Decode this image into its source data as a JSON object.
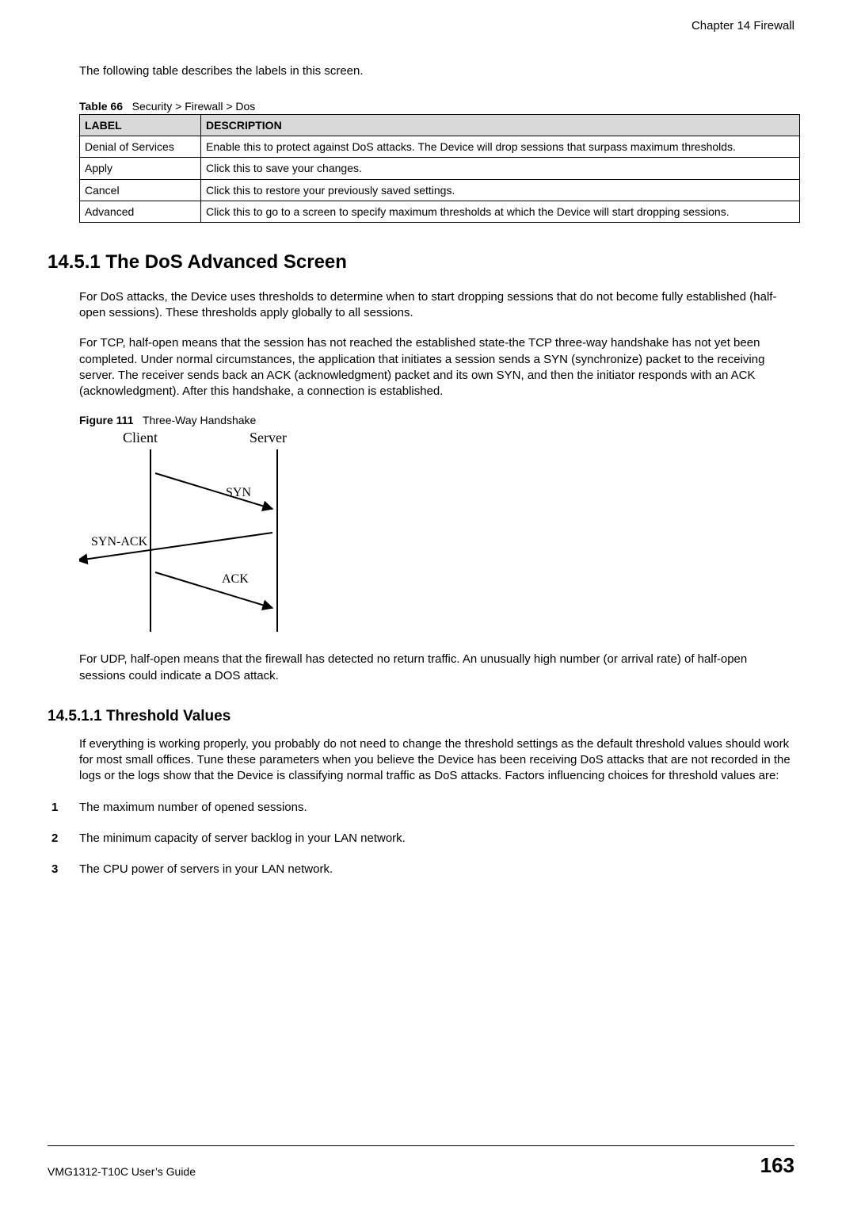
{
  "chapter_header": "Chapter 14 Firewall",
  "intro": "The following table describes the labels in this screen.",
  "table_caption_prefix": "Table 66",
  "table_caption_text": "Security > Firewall > Dos",
  "table_headers": {
    "label": "LABEL",
    "description": "DESCRIPTION"
  },
  "table_rows": [
    {
      "label": "Denial of Services",
      "description": "Enable this to protect against DoS attacks. The Device will drop sessions that surpass maximum thresholds."
    },
    {
      "label": "Apply",
      "description": "Click this to save your changes."
    },
    {
      "label": "Cancel",
      "description": "Click this to restore your previously saved settings."
    },
    {
      "label": "Advanced",
      "description": "Click this to go to a screen to specify maximum thresholds at which the Device will start dropping sessions."
    }
  ],
  "section_heading": "14.5.1  The DoS Advanced Screen",
  "para1": "For DoS attacks, the Device uses thresholds to determine when to start dropping sessions that do not become fully established (half-open sessions). These thresholds apply globally to all sessions.",
  "para2": "For TCP, half-open means that the session has not reached the established state-the TCP three-way handshake has not yet been completed. Under normal circumstances, the application that initiates a session sends a SYN (synchronize) packet to the receiving server. The receiver sends back an ACK (acknowledgment) packet and its own SYN, and then the initiator responds with an ACK (acknowledgment). After this handshake, a connection is established.",
  "figure_caption_prefix": "Figure 111",
  "figure_caption_text": "Three-Way Handshake",
  "figure_labels": {
    "client": "Client",
    "server": "Server",
    "syn": "SYN",
    "synack": "SYN-ACK",
    "ack": "ACK"
  },
  "para3": "For UDP, half-open means that the firewall has detected no return traffic. An unusually high number (or arrival rate) of half-open sessions could indicate a DOS attack.",
  "subsection_heading": "14.5.1.1  Threshold Values",
  "para4": "If everything is working properly, you probably do not need to change the threshold settings as the default threshold values should work for most small offices. Tune these parameters when you believe the Device has been receiving DoS attacks that are not recorded in the logs or the logs show that the Device is classifying normal traffic as DoS attacks. Factors influencing choices for threshold values are:",
  "list_items": [
    "The maximum number of opened sessions.",
    "The minimum capacity of server backlog in your LAN network.",
    "The CPU power of servers in your LAN network."
  ],
  "footer_left": "VMG1312-T10C User’s Guide",
  "footer_page": "163"
}
